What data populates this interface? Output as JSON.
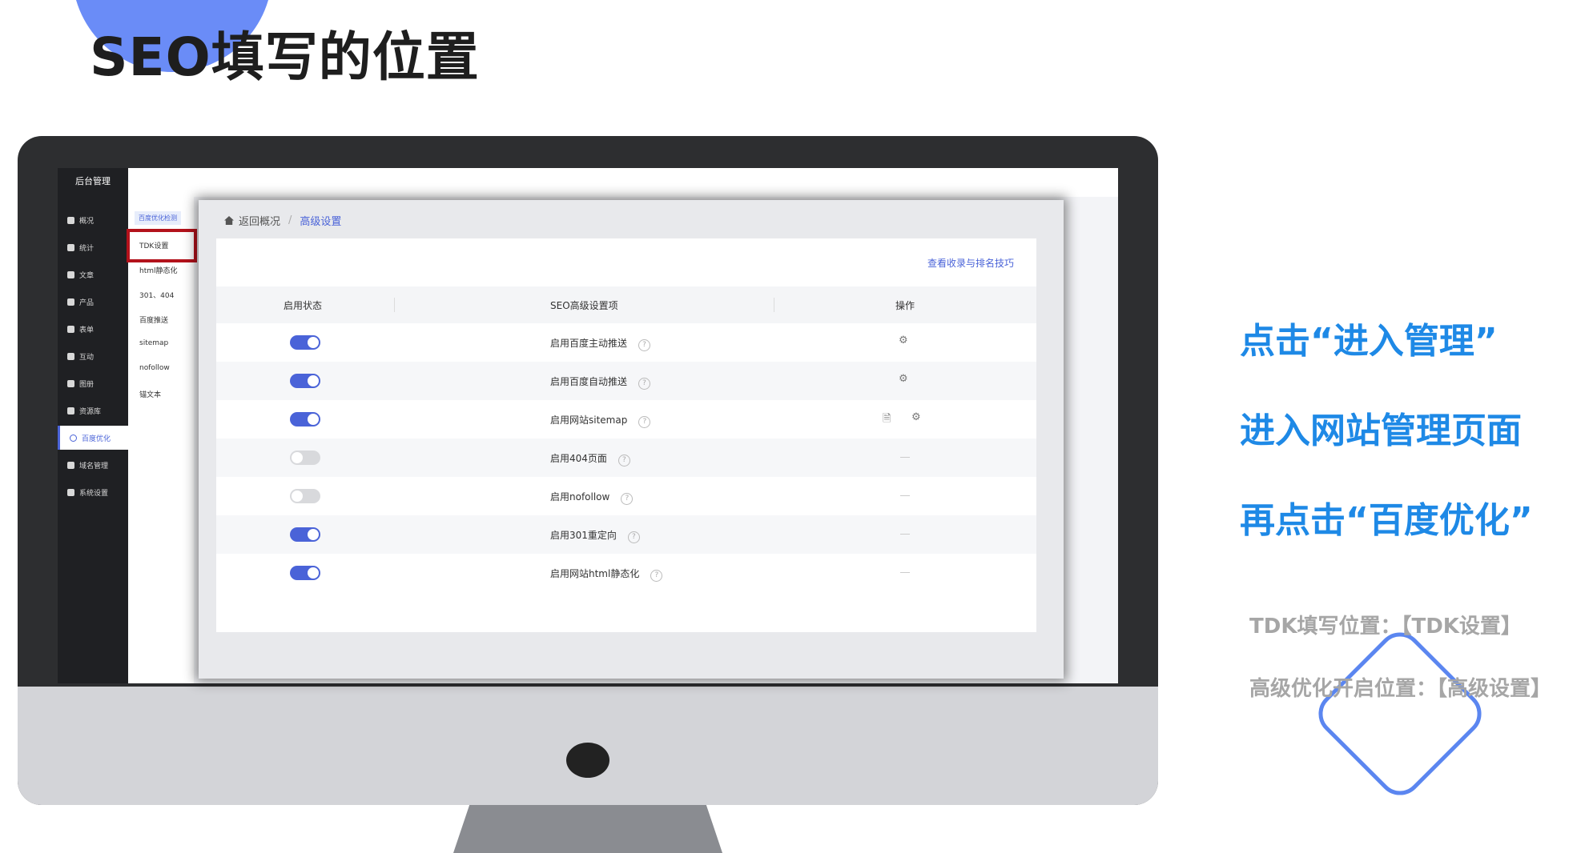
{
  "title": "SEO填写的位置",
  "sidebar": {
    "title": "后台管理",
    "items": [
      {
        "label": "概况"
      },
      {
        "label": "统计"
      },
      {
        "label": "文章"
      },
      {
        "label": "产品"
      },
      {
        "label": "表单"
      },
      {
        "label": "互动"
      },
      {
        "label": "图册"
      },
      {
        "label": "资源库"
      },
      {
        "label": "百度优化"
      },
      {
        "label": "域名管理"
      },
      {
        "label": "系统设置"
      }
    ]
  },
  "subnav": {
    "tab": "百度优化检测",
    "items": [
      "TDK设置",
      "html静态化",
      "301、404",
      "百度推送",
      "sitemap",
      "nofollow",
      "锚文本"
    ]
  },
  "breadcrumb": {
    "back": "返回概况",
    "separator": "/",
    "current": "高级设置"
  },
  "link": "查看收录与排名技巧",
  "table": {
    "headers": [
      "启用状态",
      "SEO高级设置项",
      "操作"
    ],
    "rows": [
      {
        "on": true,
        "label": "启用百度主动推送",
        "actions": [
          "⚙"
        ]
      },
      {
        "on": true,
        "label": "启用百度自动推送",
        "actions": [
          "⚙"
        ]
      },
      {
        "on": true,
        "label": "启用网站sitemap",
        "actions": [
          "🗎",
          "⚙"
        ]
      },
      {
        "on": false,
        "label": "启用404页面",
        "actions": []
      },
      {
        "on": false,
        "label": "启用nofollow",
        "actions": []
      },
      {
        "on": true,
        "label": "启用301重定向",
        "actions": []
      },
      {
        "on": true,
        "label": "启用网站html静态化",
        "actions": []
      }
    ]
  },
  "notes": {
    "line1": "点击“进入管理”",
    "line2": "进入网站管理页面",
    "line3": "再点击“百度优化”",
    "line4": "TDK填写位置：【TDK设置】",
    "line5": "高级优化开启位置：【高级设置】"
  },
  "colors": {
    "accent": "#4a63d8",
    "note_blue": "#1e89e6",
    "highlight": "#b3121b"
  }
}
